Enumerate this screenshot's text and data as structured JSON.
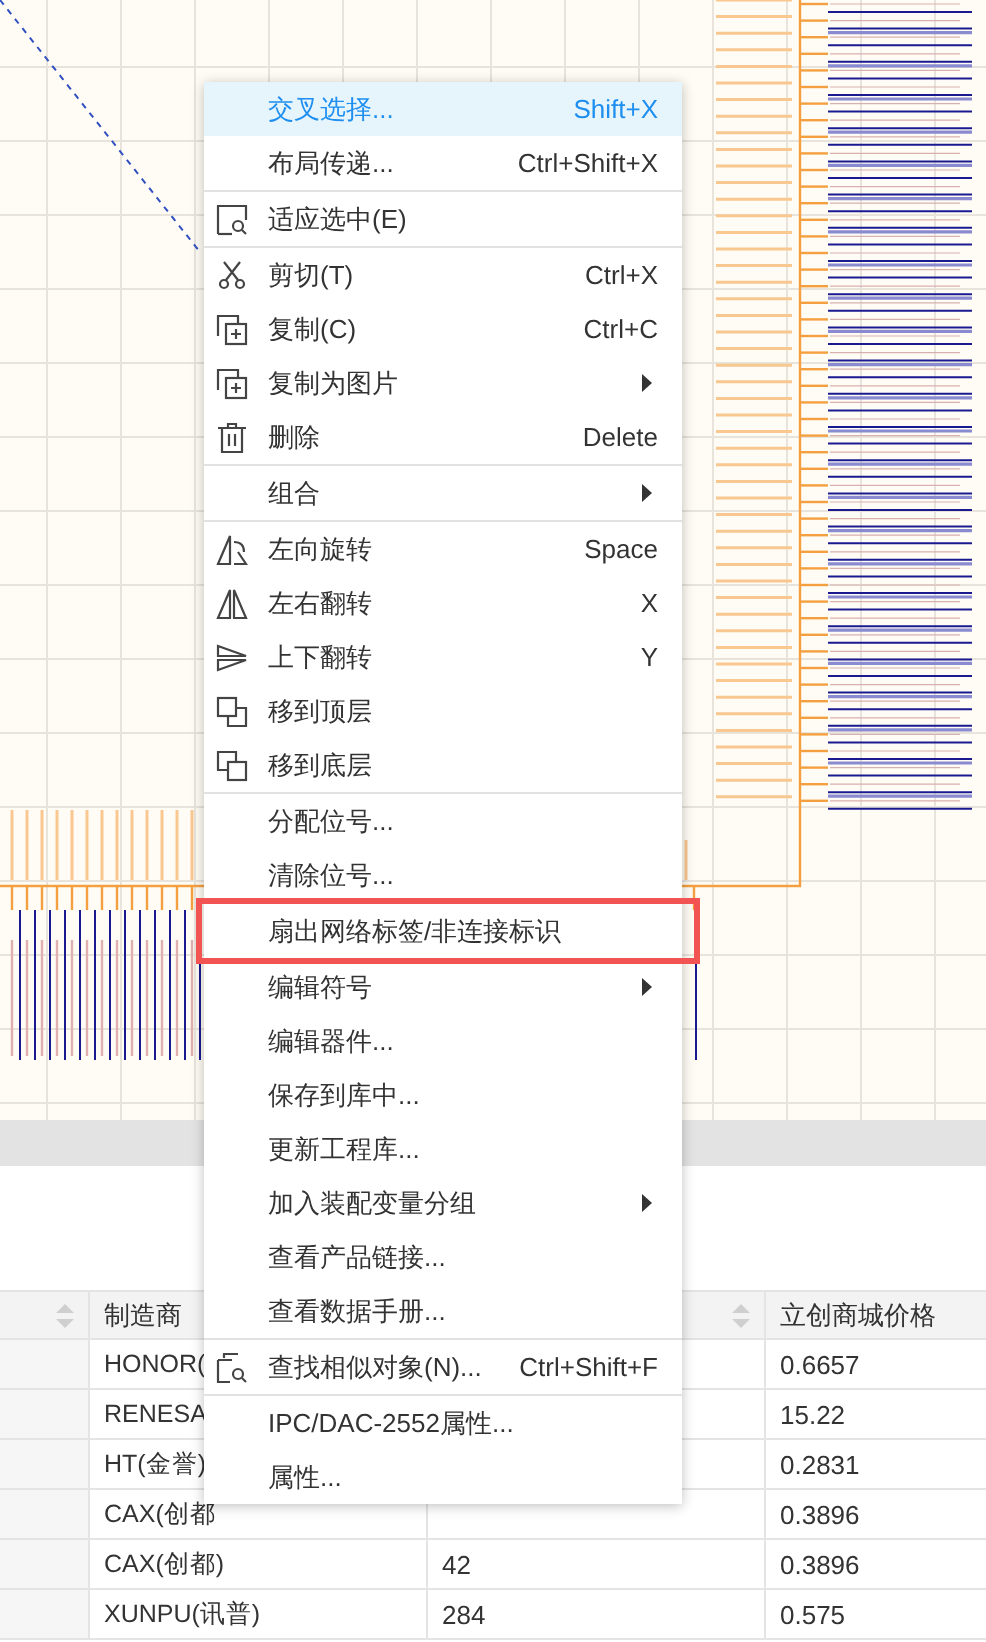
{
  "table": {
    "columns": [
      {
        "sortable": true
      },
      {
        "label": "制造商"
      },
      {
        "sortable": true
      },
      {
        "label": "立创商城价格"
      }
    ],
    "rows": [
      {
        "maker": "HONOR(",
        "price": "0.6657"
      },
      {
        "maker": "RENESA",
        "price": "15.22"
      },
      {
        "maker": "HT(金誉)",
        "price": "0.2831"
      },
      {
        "maker": "CAX(创都",
        "price": "0.3896"
      },
      {
        "maker": "CAX(创都)",
        "column_3": "42",
        "price": "0.3896"
      },
      {
        "maker": "XUNPU(讯普)",
        "column_3": "284",
        "price": "0.575"
      }
    ]
  },
  "context_menu": {
    "sections": [
      [
        {
          "label": "交叉选择...",
          "shortcut": "Shift+X",
          "submenu": false,
          "selected": true,
          "annotated": false
        },
        {
          "label": "布局传递...",
          "shortcut": "Ctrl+Shift+X",
          "submenu": false,
          "selected": false,
          "annotated": false
        }
      ],
      [
        {
          "label": "适应选中(E)",
          "submenu": false,
          "selected": false,
          "annotated": false
        }
      ],
      [
        {
          "label": "剪切(T)",
          "shortcut": "Ctrl+X",
          "submenu": false,
          "selected": false,
          "annotated": false
        },
        {
          "label": "复制(C)",
          "shortcut": "Ctrl+C",
          "submenu": false,
          "selected": false,
          "annotated": false
        },
        {
          "label": "复制为图片",
          "submenu": true,
          "selected": false,
          "annotated": false
        },
        {
          "label": "删除",
          "shortcut": "Delete",
          "submenu": false,
          "selected": false,
          "annotated": false
        }
      ],
      [
        {
          "label": "组合",
          "submenu": true,
          "selected": false,
          "annotated": false
        }
      ],
      [
        {
          "label": "左向旋转",
          "shortcut": "Space",
          "submenu": false,
          "selected": false,
          "annotated": false
        },
        {
          "label": "左右翻转",
          "shortcut": "X",
          "submenu": false,
          "selected": false,
          "annotated": false
        },
        {
          "label": "上下翻转",
          "shortcut": "Y",
          "submenu": false,
          "selected": false,
          "annotated": false
        },
        {
          "label": "移到顶层",
          "submenu": false,
          "selected": false,
          "annotated": false
        },
        {
          "label": "移到底层",
          "submenu": false,
          "selected": false,
          "annotated": false
        }
      ],
      [
        {
          "label": "分配位号...",
          "submenu": false,
          "selected": false,
          "annotated": false
        },
        {
          "label": "清除位号...",
          "submenu": false,
          "selected": false,
          "annotated": false
        },
        {
          "label": "扇出网络标签/非连接标识",
          "submenu": false,
          "selected": false,
          "annotated": true
        },
        {
          "label": "编辑符号",
          "submenu": true,
          "selected": false,
          "annotated": false
        },
        {
          "label": "编辑器件...",
          "submenu": false,
          "selected": false,
          "annotated": false
        },
        {
          "label": "保存到库中...",
          "submenu": false,
          "selected": false,
          "annotated": false
        },
        {
          "label": "更新工程库...",
          "submenu": false,
          "selected": false,
          "annotated": false
        },
        {
          "label": "加入装配变量分组",
          "submenu": true,
          "selected": false,
          "annotated": false
        },
        {
          "label": "查看产品链接...",
          "submenu": false,
          "selected": false,
          "annotated": false
        },
        {
          "label": "查看数据手册...",
          "submenu": false,
          "selected": false,
          "annotated": false
        }
      ],
      [
        {
          "label": "查找相似对象(N)...",
          "shortcut": "Ctrl+Shift+F",
          "submenu": false,
          "selected": false,
          "annotated": false
        }
      ],
      [
        {
          "label": "IPC/DAC-2552属性...",
          "submenu": false,
          "selected": false,
          "annotated": false
        },
        {
          "label": "属性...",
          "submenu": false,
          "selected": false,
          "annotated": false
        }
      ]
    ]
  }
}
